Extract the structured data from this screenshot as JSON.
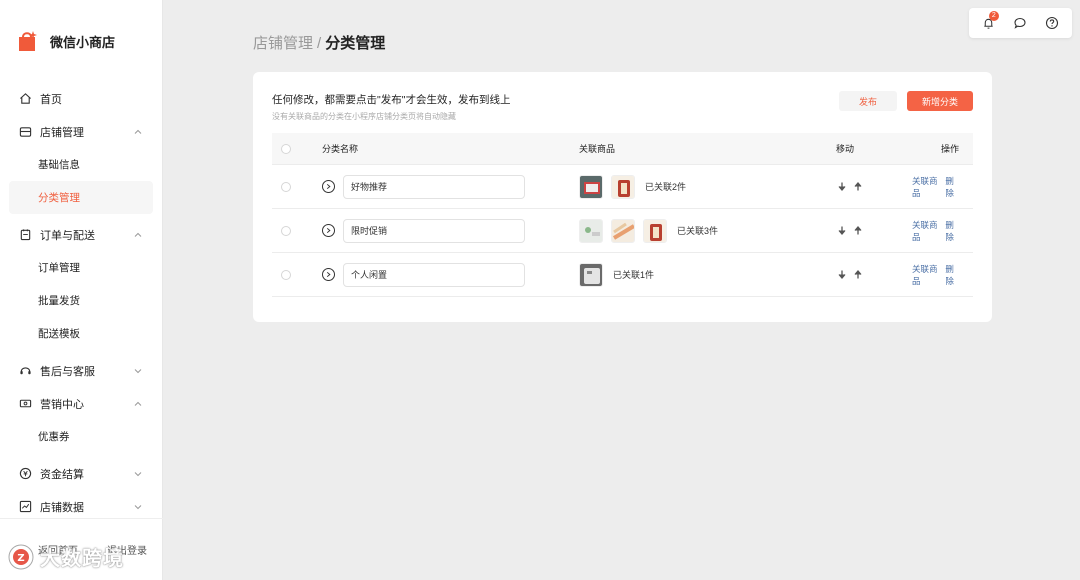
{
  "app": {
    "title": "微信小商店"
  },
  "sidebar": {
    "items": [
      {
        "label": "首页",
        "icon": "home-icon"
      },
      {
        "label": "店铺管理",
        "icon": "store-icon",
        "expanded": true,
        "children": [
          {
            "label": "基础信息"
          },
          {
            "label": "分类管理",
            "active": true
          }
        ]
      },
      {
        "label": "订单与配送",
        "icon": "order-icon",
        "expanded": true,
        "children": [
          {
            "label": "订单管理"
          },
          {
            "label": "批量发货"
          },
          {
            "label": "配送模板"
          }
        ]
      },
      {
        "label": "售后与客服",
        "icon": "headset-icon",
        "expanded": false
      },
      {
        "label": "营销中心",
        "icon": "ticket-icon",
        "expanded": true,
        "children": [
          {
            "label": "优惠券"
          }
        ]
      },
      {
        "label": "资金结算",
        "icon": "yuan-icon",
        "expanded": false
      },
      {
        "label": "店铺数据",
        "icon": "chart-icon",
        "expanded": false
      }
    ],
    "footer": {
      "left": "返回首页",
      "right": "退出登录"
    }
  },
  "toolbar": {
    "notification_count": "2",
    "icons": [
      "bell-icon",
      "message-icon",
      "help-icon"
    ]
  },
  "breadcrumb": {
    "parent": "店铺管理",
    "separator": "/",
    "current": "分类管理"
  },
  "notice": {
    "main": "任何修改，都需要点击\"发布\"才会生效，发布到线上",
    "sub": "没有关联商品的分类在小程序店铺分类页将自动隐藏"
  },
  "actions": {
    "publish": "发布",
    "add_category": "新增分类"
  },
  "table": {
    "headers": {
      "name": "分类名称",
      "goods": "关联商品",
      "move": "移动",
      "ops": "操作"
    },
    "rows": [
      {
        "name": "好物推荐",
        "goods_count": "已关联2件",
        "thumbs": 2
      },
      {
        "name": "限时促销",
        "goods_count": "已关联3件",
        "thumbs": 3
      },
      {
        "name": "个人闲置",
        "goods_count": "已关联1件",
        "thumbs": 1
      }
    ],
    "op_link_goods": "关联商品",
    "op_delete": "删除"
  },
  "watermark": {
    "text": "大数跨境"
  },
  "colors": {
    "accent": "#f46345",
    "link": "#4a6fa5",
    "background": "#ededed"
  }
}
